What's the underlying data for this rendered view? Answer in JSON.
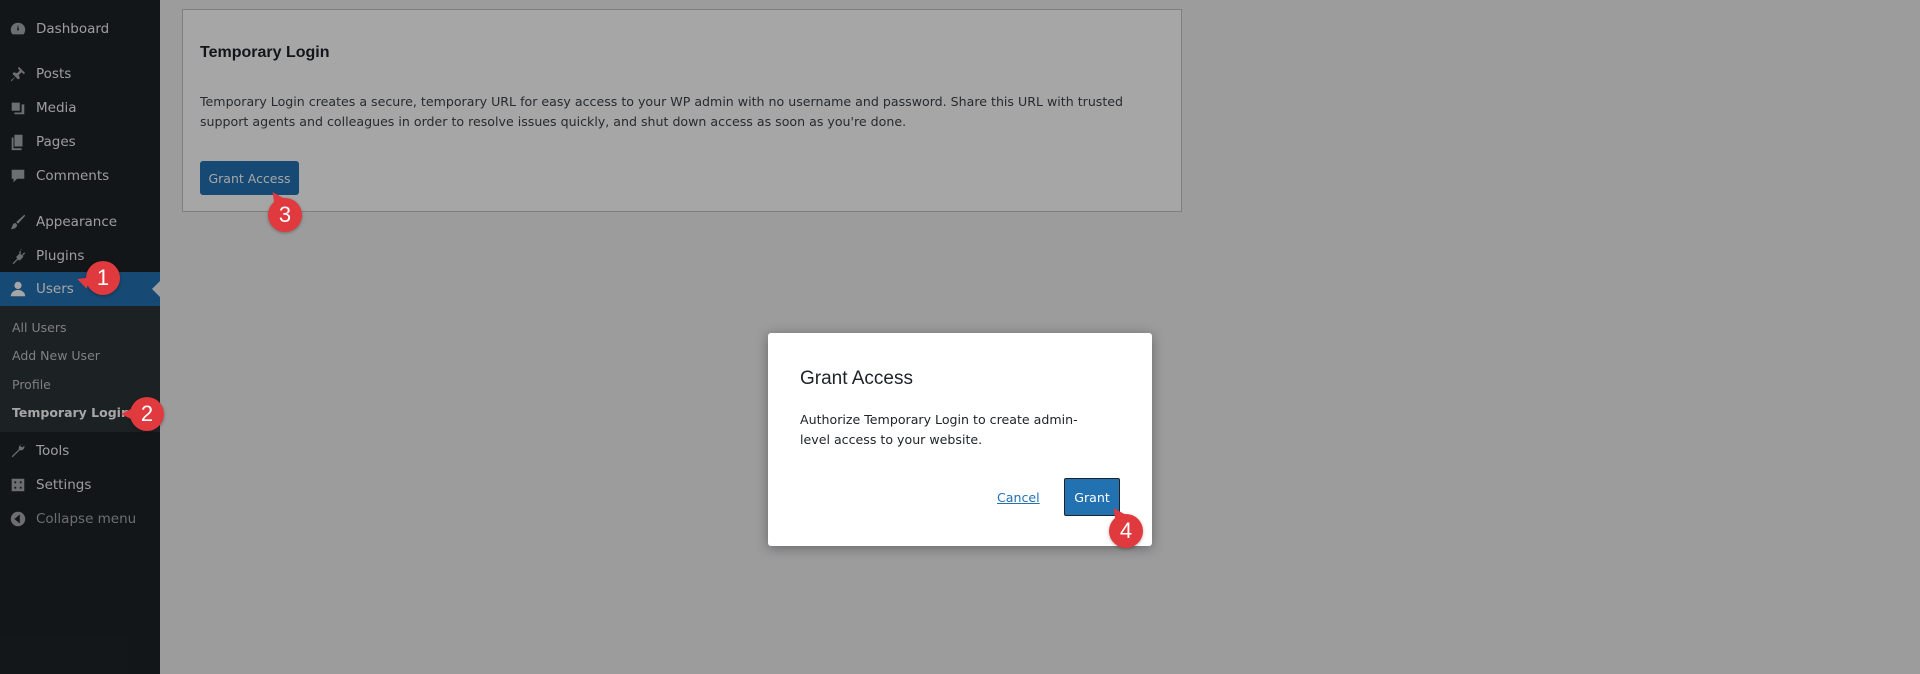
{
  "sidebar": {
    "items": [
      {
        "label": "Dashboard",
        "icon": "dashboard-icon"
      },
      {
        "label": "Posts",
        "icon": "pin-icon"
      },
      {
        "label": "Media",
        "icon": "media-icon"
      },
      {
        "label": "Pages",
        "icon": "pages-icon"
      },
      {
        "label": "Comments",
        "icon": "comment-icon"
      },
      {
        "label": "Appearance",
        "icon": "brush-icon"
      },
      {
        "label": "Plugins",
        "icon": "plug-icon"
      },
      {
        "label": "Users",
        "icon": "user-icon"
      },
      {
        "label": "Tools",
        "icon": "wrench-icon"
      },
      {
        "label": "Settings",
        "icon": "settings-icon"
      },
      {
        "label": "Collapse menu",
        "icon": "collapse-icon"
      }
    ],
    "submenu": [
      {
        "label": "All Users"
      },
      {
        "label": "Add New User"
      },
      {
        "label": "Profile"
      },
      {
        "label": "Temporary Login"
      }
    ]
  },
  "card": {
    "title": "Temporary Login",
    "description": "Temporary Login creates a secure, temporary URL for easy access to your WP admin with no username and password. Share this URL with trusted support agents and colleagues in order to resolve issues quickly, and shut down access as soon as you're done.",
    "button_label": "Grant Access"
  },
  "modal": {
    "title": "Grant Access",
    "description": "Authorize Temporary Login to create admin-level access to your website.",
    "cancel_label": "Cancel",
    "grant_label": "Grant"
  },
  "steps": [
    "1",
    "2",
    "3",
    "4"
  ],
  "colors": {
    "sidebar_bg": "#1d2327",
    "active_blue": "#2271b1",
    "step_red": "#e0393e"
  }
}
